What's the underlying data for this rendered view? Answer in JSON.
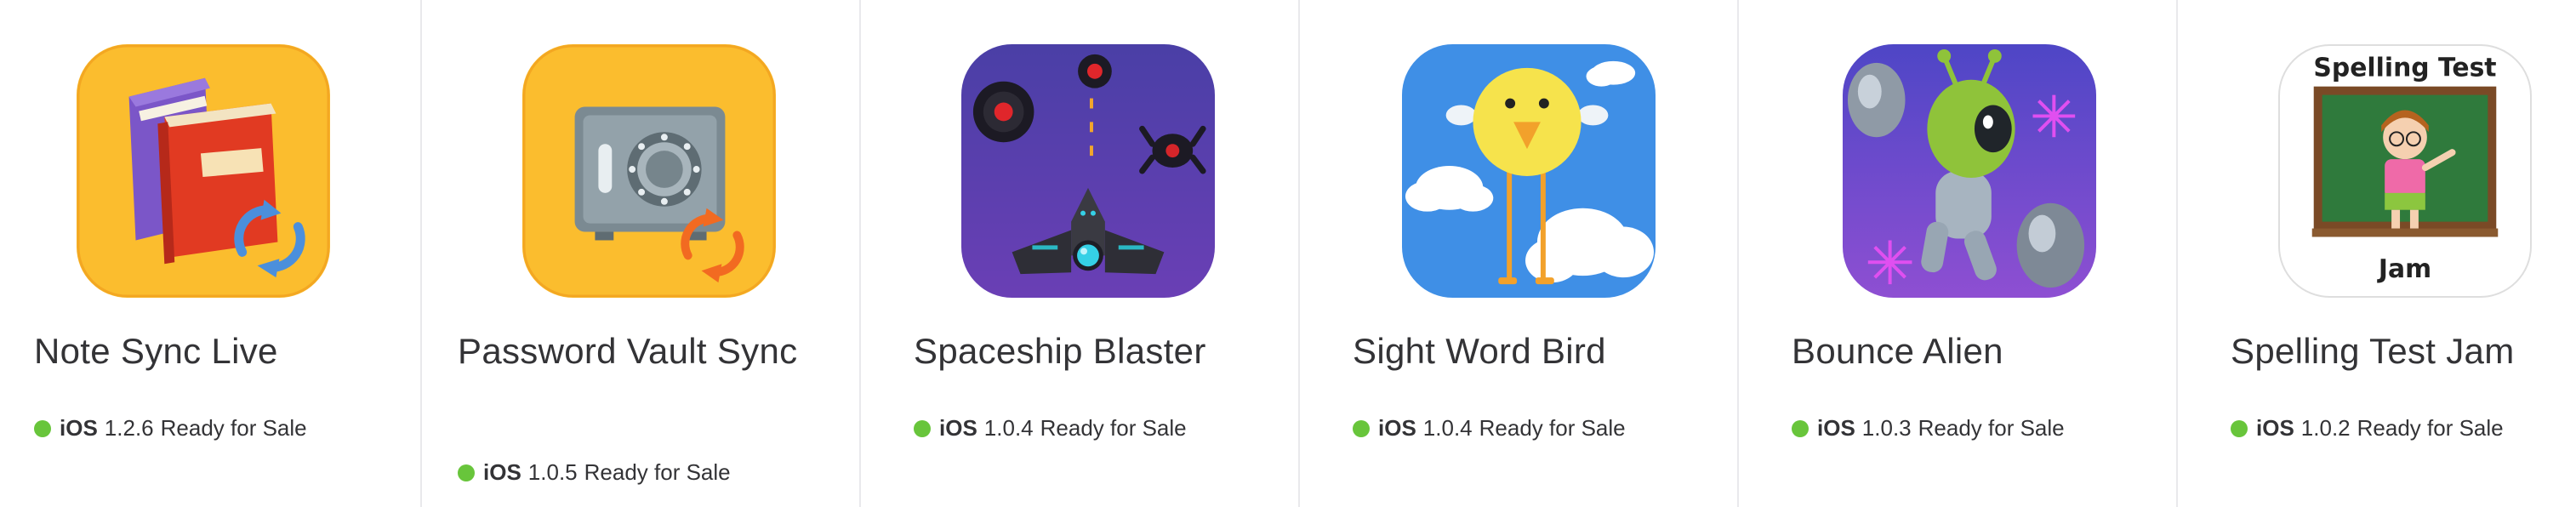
{
  "apps": [
    {
      "name": "Note Sync Live",
      "platform": "iOS",
      "version": "1.2.6",
      "state": "Ready for Sale",
      "icon": "note-sync-live-icon"
    },
    {
      "name": "Password Vault Sync",
      "platform": "iOS",
      "version": "1.0.5",
      "state": "Ready for Sale",
      "icon": "password-vault-sync-icon"
    },
    {
      "name": "Spaceship Blaster",
      "platform": "iOS",
      "version": "1.0.4",
      "state": "Ready for Sale",
      "icon": "spaceship-blaster-icon"
    },
    {
      "name": "Sight Word Bird",
      "platform": "iOS",
      "version": "1.0.4",
      "state": "Ready for Sale",
      "icon": "sight-word-bird-icon"
    },
    {
      "name": "Bounce Alien",
      "platform": "iOS",
      "version": "1.0.3",
      "state": "Ready for Sale",
      "icon": "bounce-alien-icon"
    },
    {
      "name": "Spelling Test Jam",
      "platform": "iOS",
      "version": "1.0.2",
      "state": "Ready for Sale",
      "icon": "spelling-test-jam-icon",
      "icon_text_top": "Spelling Test",
      "icon_text_bottom": "Jam"
    }
  ],
  "colors": {
    "status_dot": "#68c53b",
    "divider": "#e9e9ec",
    "text": "#333336"
  }
}
